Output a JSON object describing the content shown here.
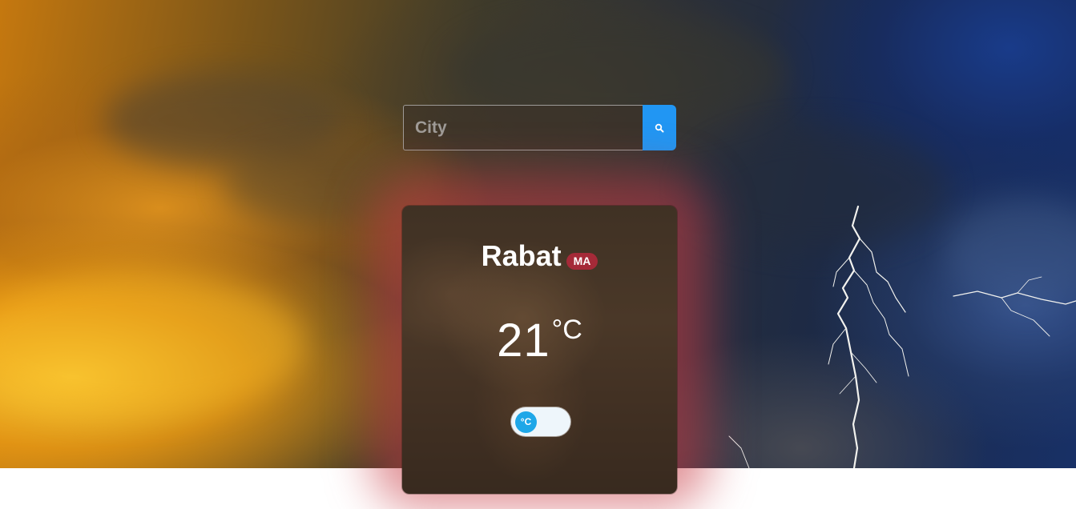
{
  "search": {
    "placeholder": "City",
    "button_icon": "search-icon",
    "button_color": "#2196f3"
  },
  "weather_card": {
    "city": "Rabat",
    "country_code": "MA",
    "temperature": "21",
    "unit_symbol": "°C",
    "unit_toggle_label": "°C",
    "badge_color": "#a52a38",
    "glow_color": "#c83c46"
  },
  "colors": {
    "toggle_knob": "#1ea7e8",
    "toggle_track": "#eef6fb"
  }
}
